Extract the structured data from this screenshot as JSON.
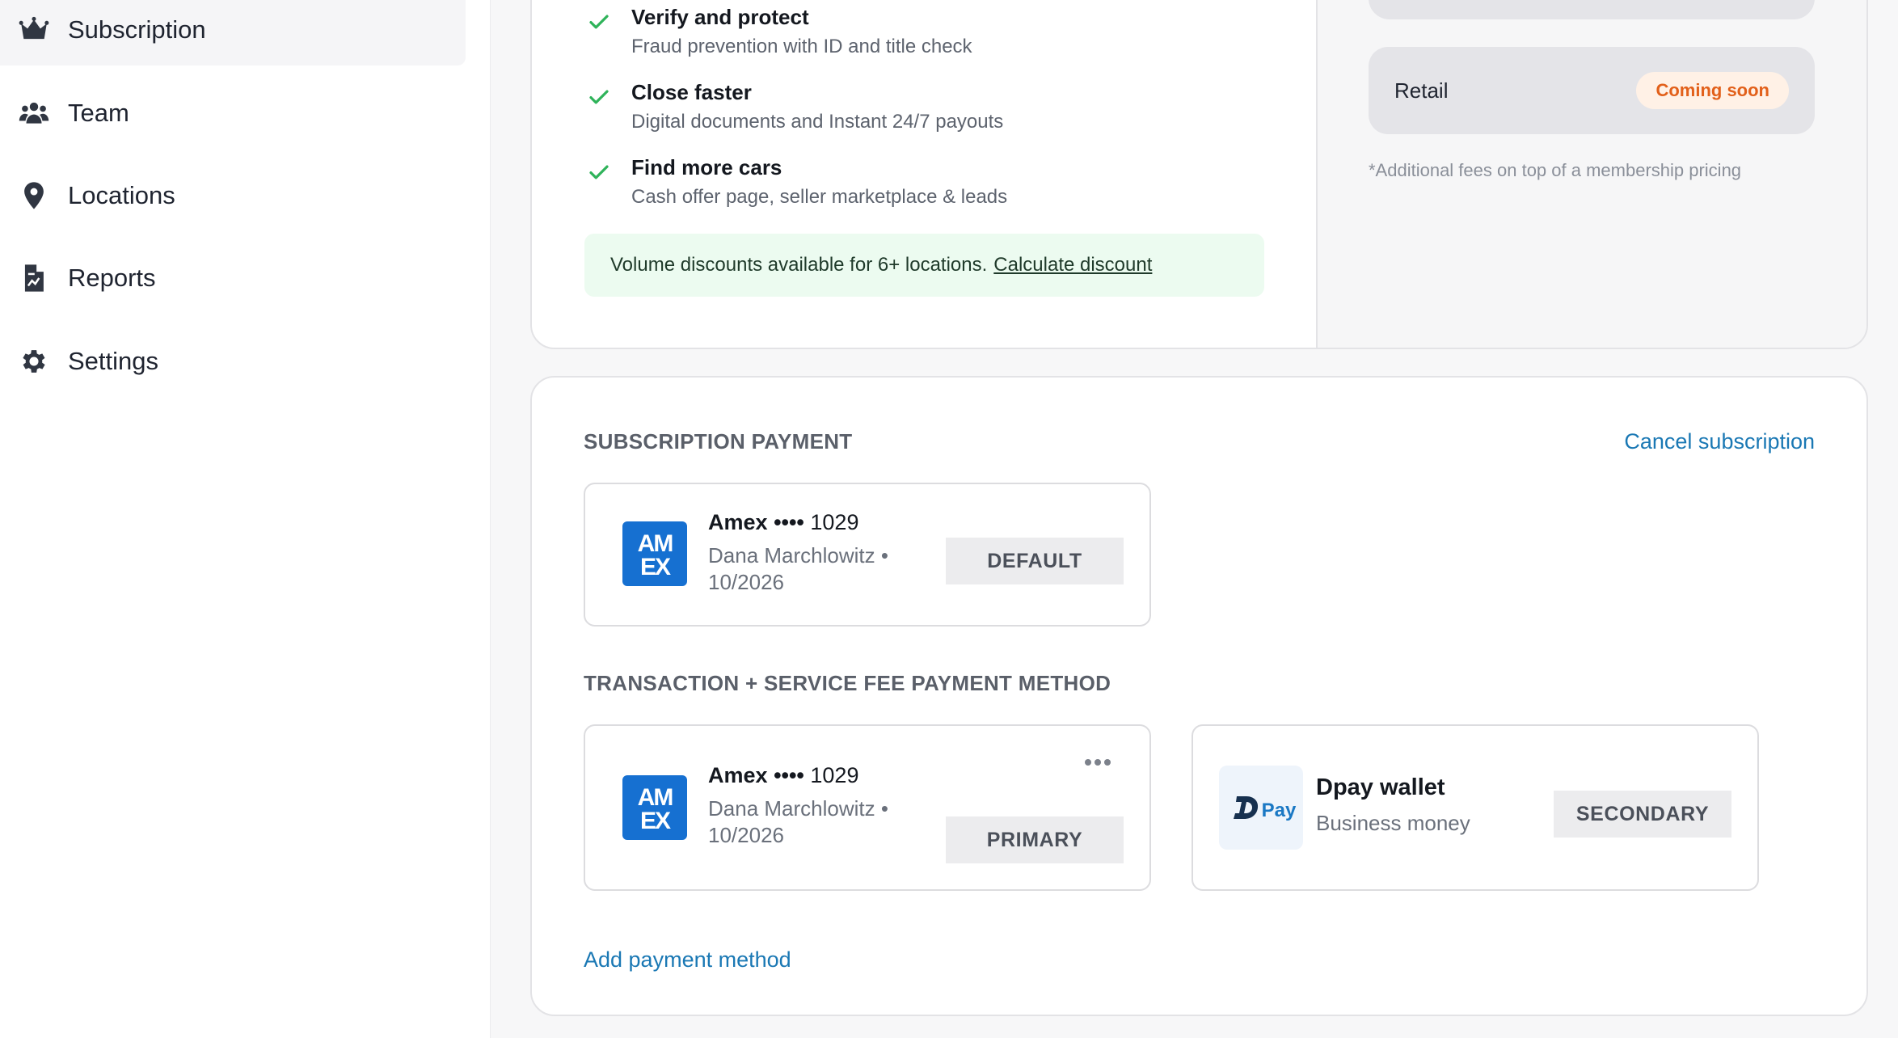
{
  "sidebar": {
    "items": [
      {
        "label": "Subscription",
        "icon": "crown-icon"
      },
      {
        "label": "Team",
        "icon": "users-icon"
      },
      {
        "label": "Locations",
        "icon": "map-pin-icon"
      },
      {
        "label": "Reports",
        "icon": "report-icon"
      },
      {
        "label": "Settings",
        "icon": "gear-icon"
      }
    ],
    "active": "Subscription"
  },
  "plan": {
    "features": [
      {
        "title": "Verify and protect",
        "subtitle": "Fraud prevention with ID and title check"
      },
      {
        "title": "Close faster",
        "subtitle": "Digital documents and Instant 24/7 payouts"
      },
      {
        "title": "Find more cars",
        "subtitle": "Cash offer page, seller marketplace & leads"
      }
    ],
    "discount_text": "Volume discounts available for 6+ locations.",
    "discount_link": "Calculate discount",
    "retail_label": "Retail",
    "retail_badge": "Coming soon",
    "fees_note": "*Additional fees on top of a membership pricing"
  },
  "payment": {
    "subscription_title": "SUBSCRIPTION PAYMENT",
    "cancel_link": "Cancel subscription",
    "subscription_method": {
      "brand": "Amex",
      "mask": "••••",
      "last4": "1029",
      "holder": "Dana Marchlowitz •",
      "expiry": "10/2026",
      "tag": "DEFAULT"
    },
    "transaction_title": "TRANSACTION + SERVICE FEE PAYMENT METHOD",
    "primary_method": {
      "brand": "Amex",
      "mask": "••••",
      "last4": "1029",
      "holder": "Dana Marchlowitz •",
      "expiry": "10/2026",
      "tag": "PRIMARY"
    },
    "secondary_method": {
      "logo_text": "Pay",
      "title": "Dpay wallet",
      "subtitle": "Business money",
      "tag": "SECONDARY"
    },
    "add_link": "Add payment method"
  },
  "colors": {
    "accent_link": "#1a78b4",
    "check_green": "#2fb35a",
    "amex_blue": "#1670d1",
    "badge_orange": "#e2601a",
    "discount_bg": "#ecfbf0"
  }
}
